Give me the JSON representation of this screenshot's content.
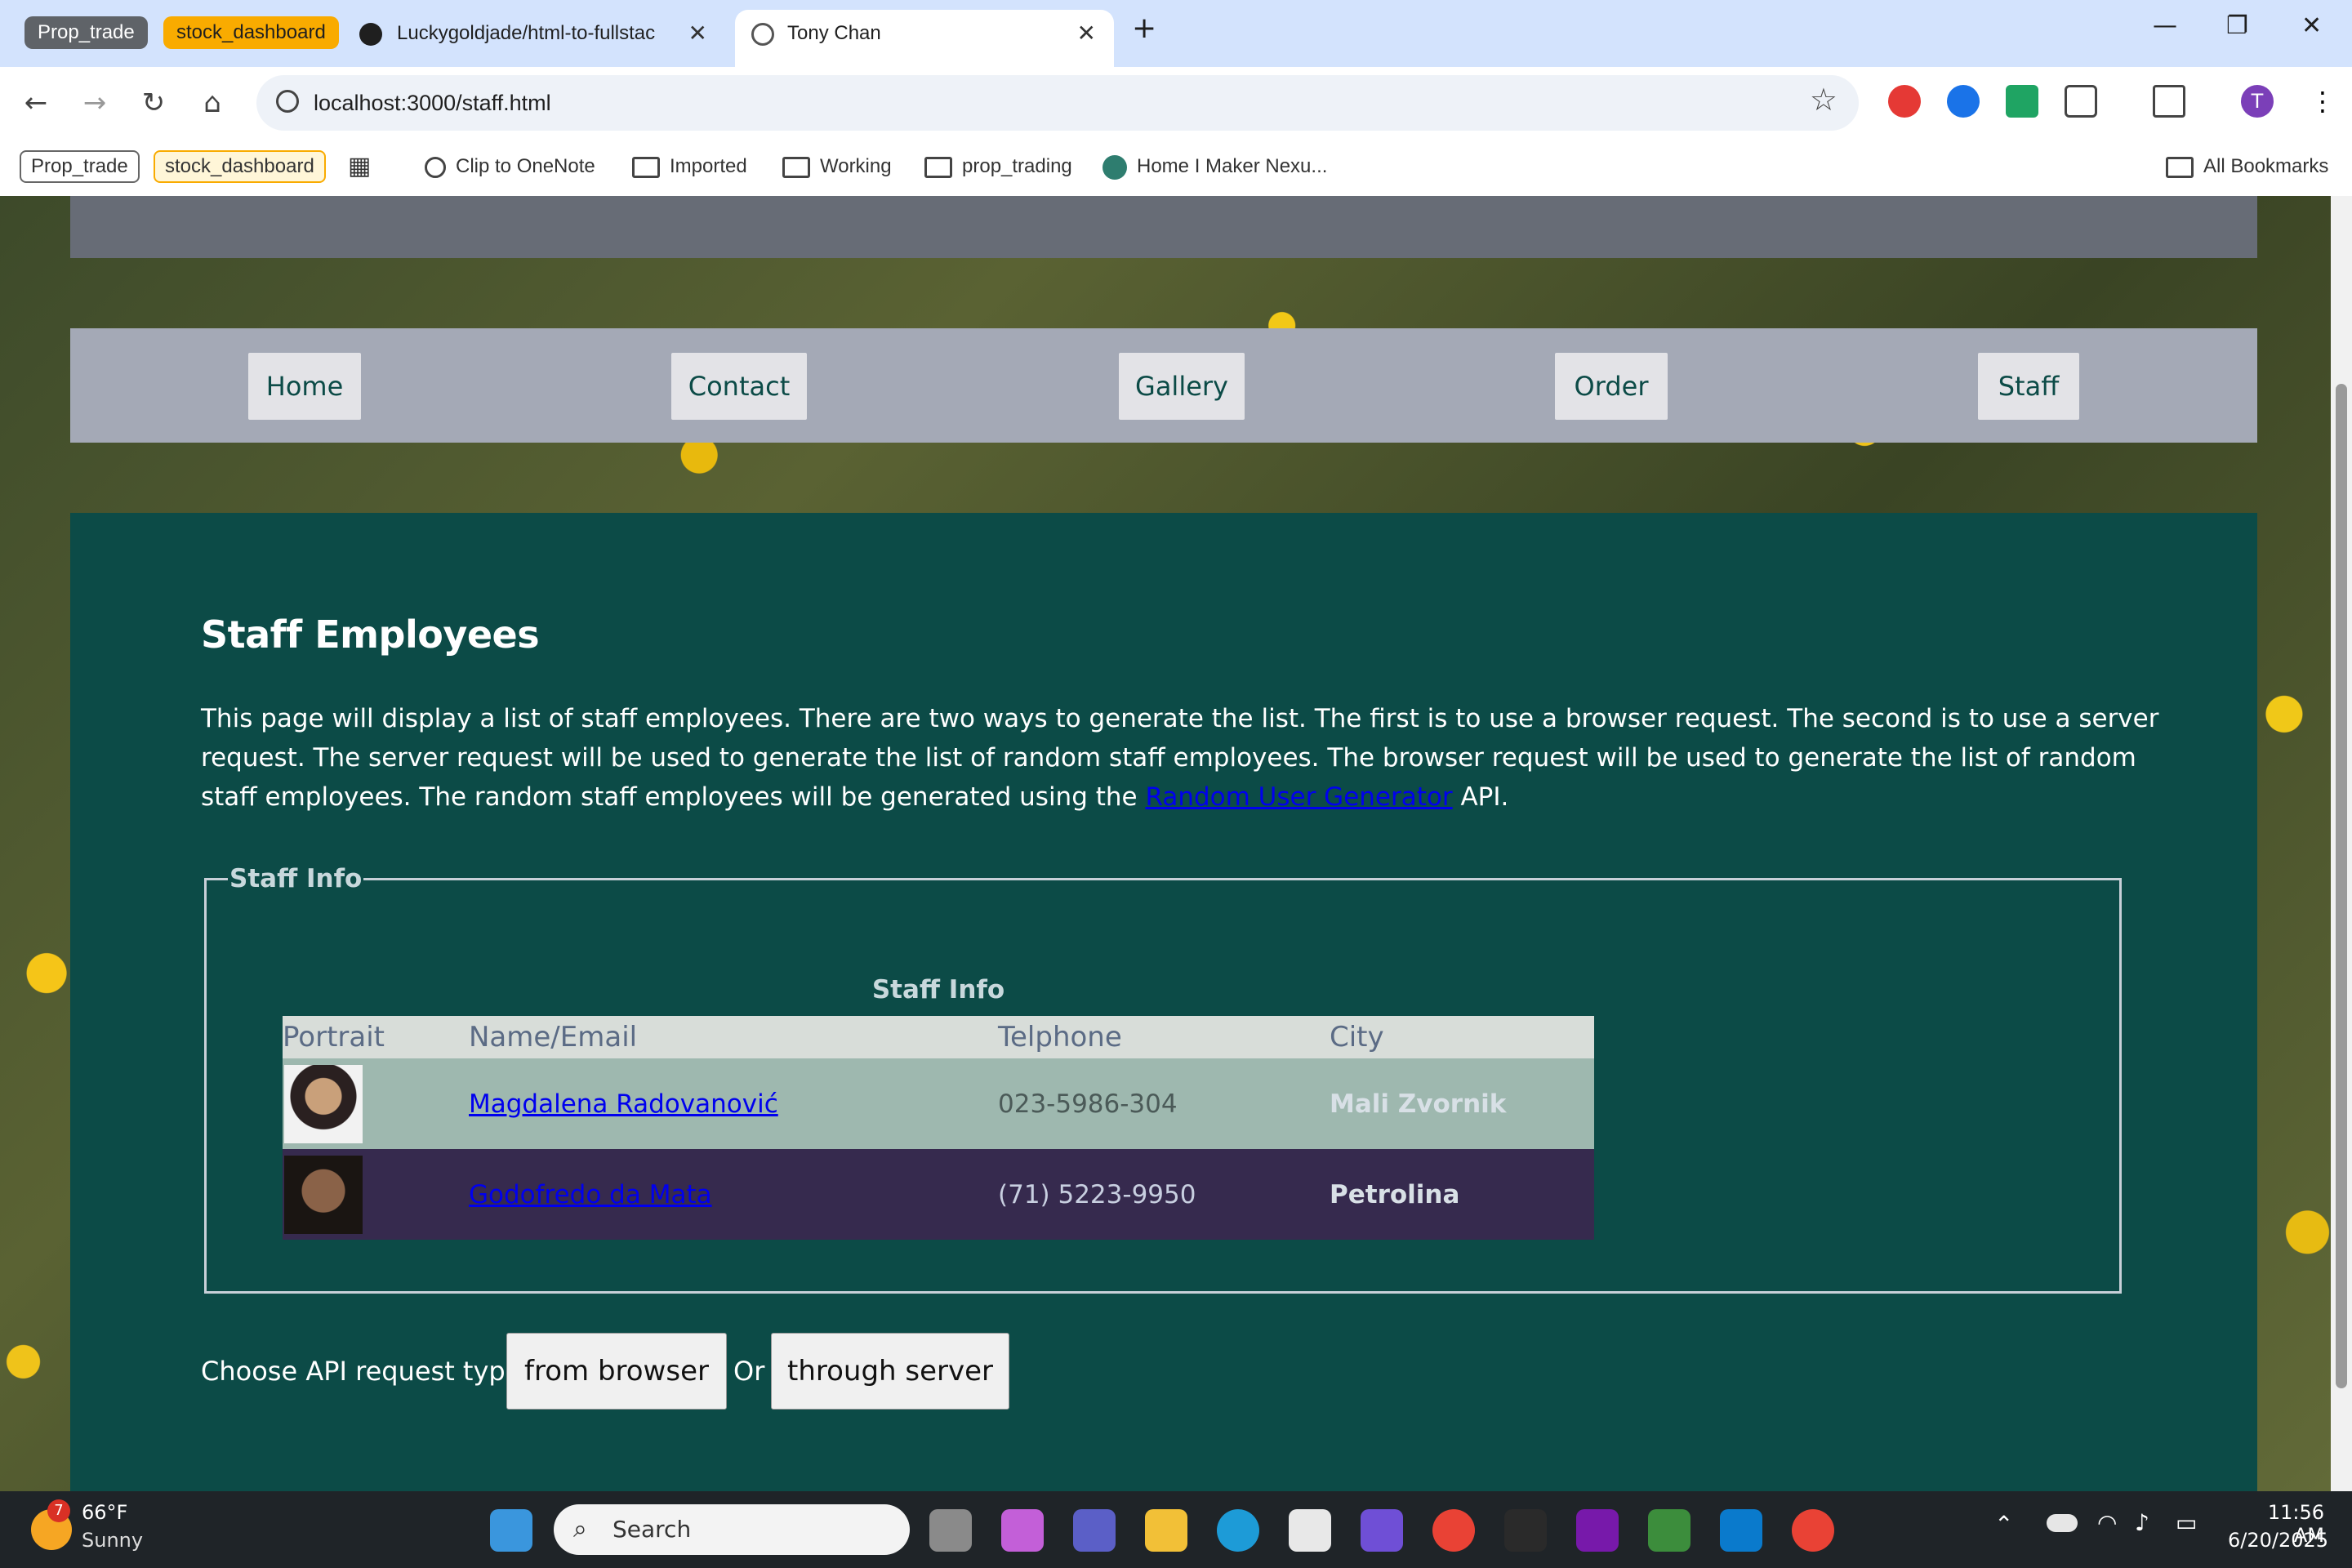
{
  "browser": {
    "tab_groups": [
      "Prop_trade",
      "stock_dashboard"
    ],
    "tabs": [
      {
        "title": "Luckygoldjade/html-to-fullstac"
      },
      {
        "title": "Tony Chan"
      }
    ],
    "url": "localhost:3000/staff.html",
    "profile_initial": "T",
    "bookmarks": {
      "groups": [
        "Prop_trade",
        "stock_dashboard"
      ],
      "items": [
        "Clip to OneNote",
        "Imported",
        "Working",
        "prop_trading",
        "Home I Maker Nexu..."
      ],
      "all": "All Bookmarks"
    }
  },
  "nav": {
    "links": [
      "Home",
      "Contact",
      "Gallery",
      "Order",
      "Staff"
    ]
  },
  "page": {
    "title": "Staff Employees",
    "intro_before_link": "This page will display a list of staff employees. There are two ways to generate the list. The first is to use a browser request. The second is to use a server request. The server request will be used to generate the list of random staff employees. The browser request will be used to generate the list of random staff employees. The random staff employees will be generated using the ",
    "intro_link": "Random User Generator",
    "intro_after_link": " API.",
    "fieldset_legend": "Staff Info",
    "table_caption": "Staff Info",
    "columns": [
      "Portrait",
      "Name/Email",
      "Telphone",
      "City"
    ],
    "rows": [
      {
        "name": "Magdalena Radovanović",
        "phone": "023-5986-304",
        "city": "Mali Zvornik"
      },
      {
        "name": "Godofredo da Mata",
        "phone": "(71) 5223-9950",
        "city": "Petrolina"
      }
    ],
    "api_label": "Choose API request type:",
    "btn_browser": "from browser",
    "or_label": "Or",
    "btn_server": "through server"
  },
  "taskbar": {
    "weather_temp": "66°F",
    "weather_text": "Sunny",
    "weather_badge": "7",
    "search_placeholder": "Search",
    "time": "11:56 AM",
    "date": "6/20/2025"
  },
  "colors": {
    "main_bg": "#0c4b47",
    "nav_bg": "#a4a9b6",
    "row1": "#9eb8af",
    "row2": "#362a4e"
  }
}
